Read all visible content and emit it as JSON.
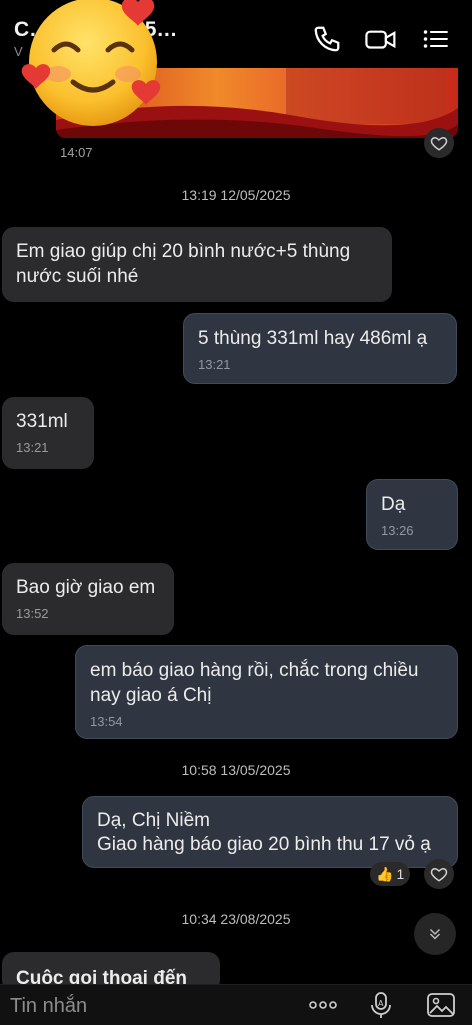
{
  "header": {
    "title": "C… uy 077695…",
    "subtitle": "V",
    "icons": [
      "phone-icon",
      "video-call-icon",
      "menu-icon"
    ]
  },
  "messages": {
    "image_time": "14:07",
    "date1": "13:19 12/05/2025",
    "m1_text": "Em giao giúp chị  20 bình nước+5 thùng nước suối nhé",
    "m2_text": "5 thùng 331ml hay 486ml ạ",
    "m2_time": "13:21",
    "m3_text": "331ml",
    "m3_time": "13:21",
    "m4_text": "Dạ",
    "m4_time": "13:26",
    "m5_text": "Bao giờ giao em",
    "m5_time": "13:52",
    "m6_text": "em báo giao hàng rồi, chắc trong chiều nay giao á Chị",
    "m6_time": "13:54",
    "date2": "10:58 13/05/2025",
    "m7_line1": "Dạ, Chị Niềm",
    "m7_line2": "Giao hàng báo giao 20 bình thu 17 vỏ ạ",
    "m7_reaction_count": "1",
    "date3": "10:34 23/08/2025",
    "m8_text": "Cuộc gọi thoại đến"
  },
  "input": {
    "placeholder": "Tin nhắn",
    "icons": [
      "more-icon",
      "voice-icon",
      "image-icon"
    ]
  },
  "colors": {
    "background": "#000000",
    "incoming_bubble": "#2b2b2d",
    "outgoing_bubble": "#2f3642"
  }
}
